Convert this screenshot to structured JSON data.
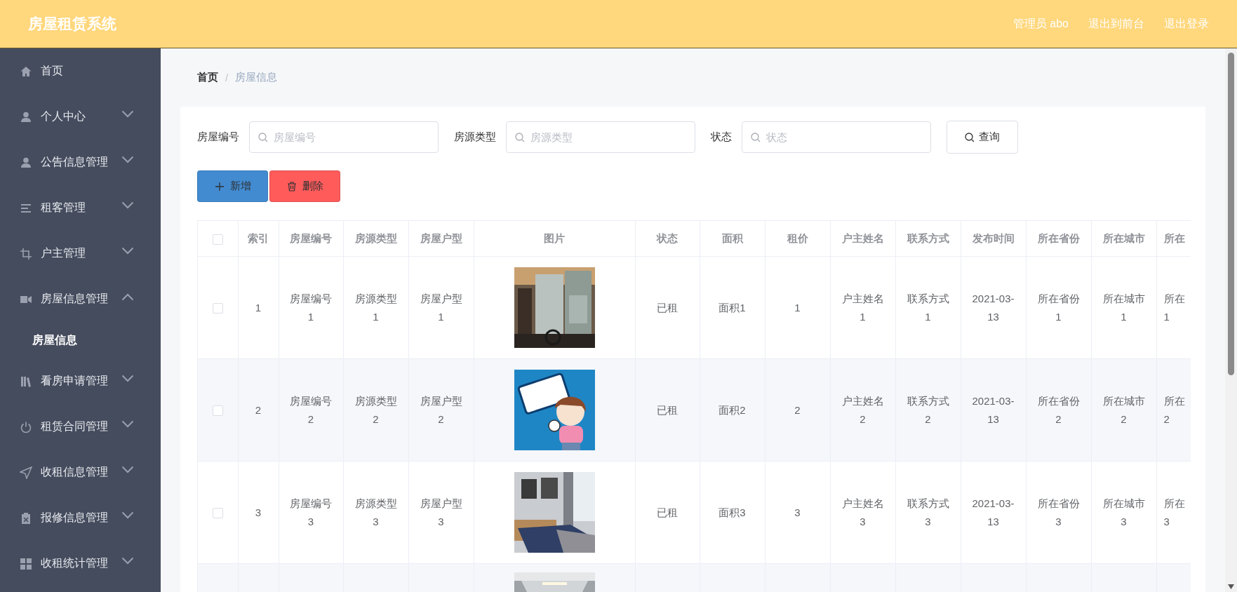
{
  "header": {
    "title": "房屋租赁系统",
    "links": [
      "管理员 abo",
      "退出到前台",
      "退出登录"
    ]
  },
  "sidebar": {
    "items": [
      {
        "label": "首页",
        "kind": "link"
      },
      {
        "label": "个人中心",
        "kind": "submenu",
        "expanded": false
      },
      {
        "label": "公告信息管理",
        "kind": "submenu",
        "expanded": false
      },
      {
        "label": "租客管理",
        "kind": "submenu",
        "expanded": false
      },
      {
        "label": "户主管理",
        "kind": "submenu",
        "expanded": false
      },
      {
        "label": "房屋信息管理",
        "kind": "submenu",
        "expanded": true,
        "children": [
          {
            "label": "房屋信息",
            "selected": true
          }
        ]
      },
      {
        "label": "看房申请管理",
        "kind": "submenu",
        "expanded": false
      },
      {
        "label": "租赁合同管理",
        "kind": "submenu",
        "expanded": false
      },
      {
        "label": "收租信息管理",
        "kind": "submenu",
        "expanded": false
      },
      {
        "label": "报修信息管理",
        "kind": "submenu",
        "expanded": false
      },
      {
        "label": "收租统计管理",
        "kind": "submenu",
        "expanded": false
      }
    ]
  },
  "breadcrumb": {
    "items": [
      "首页",
      "房屋信息"
    ],
    "separator": "/"
  },
  "search": {
    "fields": [
      {
        "label": "房屋编号",
        "placeholder": "房屋编号"
      },
      {
        "label": "房源类型",
        "placeholder": "房源类型"
      },
      {
        "label": "状态",
        "placeholder": "状态"
      }
    ],
    "button": "查询"
  },
  "actions": {
    "add": "新增",
    "delete": "删除"
  },
  "table": {
    "header_checked": false,
    "columns": [
      "索引",
      "房屋编号",
      "房源类型",
      "房屋户型",
      "图片",
      "状态",
      "面积",
      "租价",
      "户主姓名",
      "联系方式",
      "发布时间",
      "所在省份",
      "所在城市",
      "所在"
    ],
    "rows": [
      {
        "checked": false,
        "cells": [
          "1",
          "房屋编号1",
          "房源类型1",
          "房屋户型1",
          {
            "kind": "picture"
          },
          "已租",
          "面积1",
          "1",
          "户主姓名1",
          "联系方式1",
          "2021-03-13",
          "所在省份1",
          "所在城市1",
          "所在1"
        ]
      },
      {
        "checked": false,
        "cells": [
          "2",
          "房屋编号2",
          "房源类型2",
          "房屋户型2",
          {
            "kind": "picture"
          },
          "已租",
          "面积2",
          "2",
          "户主姓名2",
          "联系方式2",
          "2021-03-13",
          "所在省份2",
          "所在城市2",
          "所在2"
        ]
      },
      {
        "checked": false,
        "cells": [
          "3",
          "房屋编号3",
          "房源类型3",
          "房屋户型3",
          {
            "kind": "picture"
          },
          "已租",
          "面积3",
          "3",
          "户主姓名3",
          "联系方式3",
          "2021-03-13",
          "所在省份3",
          "所在城市3",
          "所在3"
        ]
      },
      {
        "cells": [
          null,
          null,
          null,
          null,
          {
            "kind": "picture"
          }
        ]
      }
    ]
  }
}
